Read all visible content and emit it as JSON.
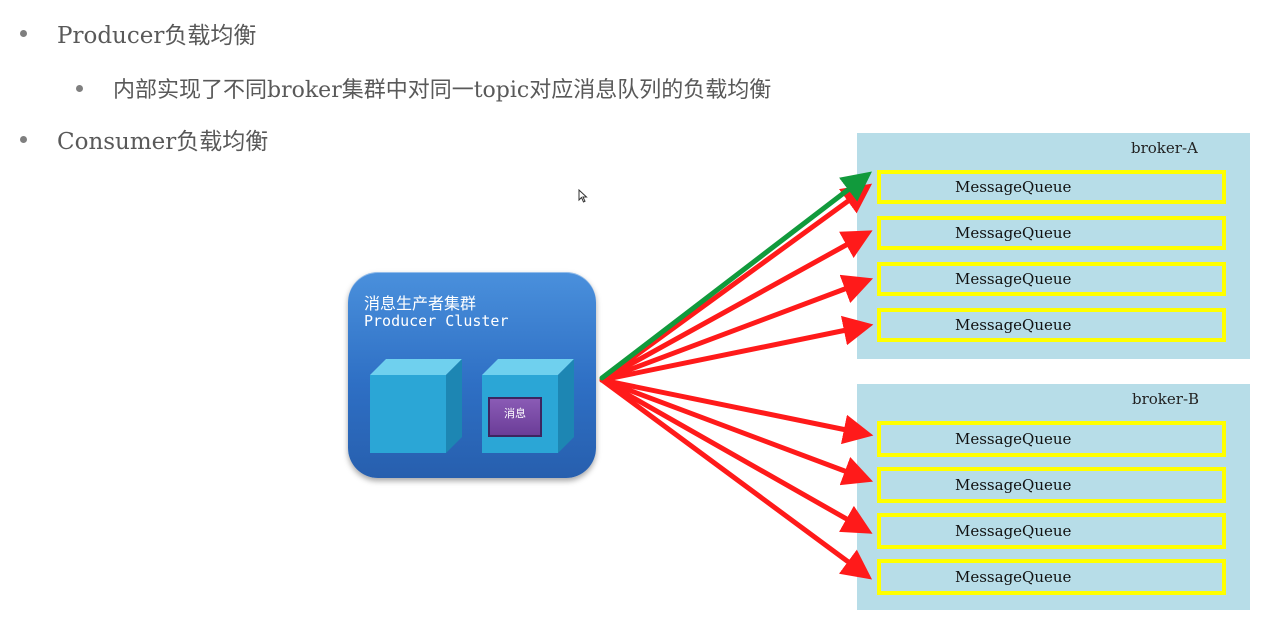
{
  "bullets": {
    "producer": "Producer负载均衡",
    "producer_sub": "内部实现了不同broker集群中对同一topic对应消息队列的负载均衡",
    "consumer": "Consumer负载均衡"
  },
  "producer_cluster": {
    "title_cn": "消息生产者集群",
    "title_en": "Producer Cluster",
    "message_label": "消息"
  },
  "brokers": [
    {
      "label": "broker-A",
      "queues": [
        "MessageQueue",
        "MessageQueue",
        "MessageQueue",
        "MessageQueue"
      ]
    },
    {
      "label": "broker-B",
      "queues": [
        "MessageQueue",
        "MessageQueue",
        "MessageQueue",
        "MessageQueue"
      ]
    }
  ],
  "arrows": {
    "active_color": "#119a3c",
    "inactive_color": "#ff1a1a",
    "active_target": "broker-A queue 1"
  },
  "colors": {
    "broker_bg": "#b7dde8",
    "queue_border": "#ffff00",
    "cluster_bg": "#2e6fc4"
  }
}
